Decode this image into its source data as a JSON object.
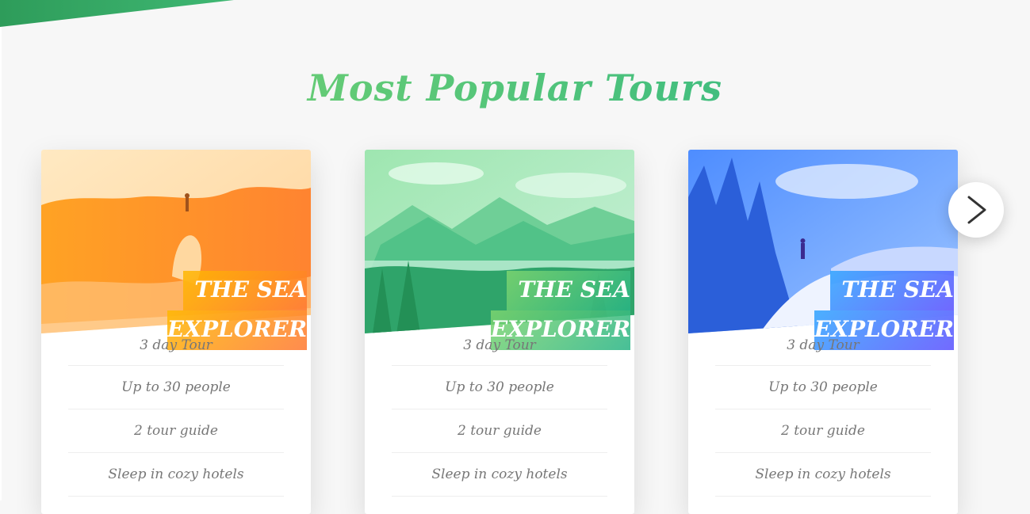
{
  "section": {
    "title": "Most Popular Tours"
  },
  "tours": [
    {
      "heading_line1": "THE SEA",
      "heading_line2": "EXPLORER",
      "theme": "orange",
      "details": [
        "3 day Tour",
        "Up to 30 people",
        "2 tour guide",
        "Sleep in cozy hotels"
      ]
    },
    {
      "heading_line1": "THE SEA",
      "heading_line2": "EXPLORER",
      "theme": "green",
      "details": [
        "3 day Tour",
        "Up to 30 people",
        "2 tour guide",
        "Sleep in cozy hotels"
      ]
    },
    {
      "heading_line1": "THE SEA",
      "heading_line2": "EXPLORER",
      "theme": "blue",
      "details": [
        "3 day Tour",
        "Up to 30 people",
        "2 tour guide",
        "Sleep in cozy hotels"
      ]
    }
  ],
  "carousel": {
    "next_icon": "chevron-right-icon"
  },
  "colors": {
    "primary_light": "#7ed56f",
    "primary_dark": "#28b485",
    "secondary_light": "#ffb900",
    "secondary_dark": "#ff7730",
    "tertiary_light": "#2998ff",
    "tertiary_dark": "#5643fa"
  }
}
